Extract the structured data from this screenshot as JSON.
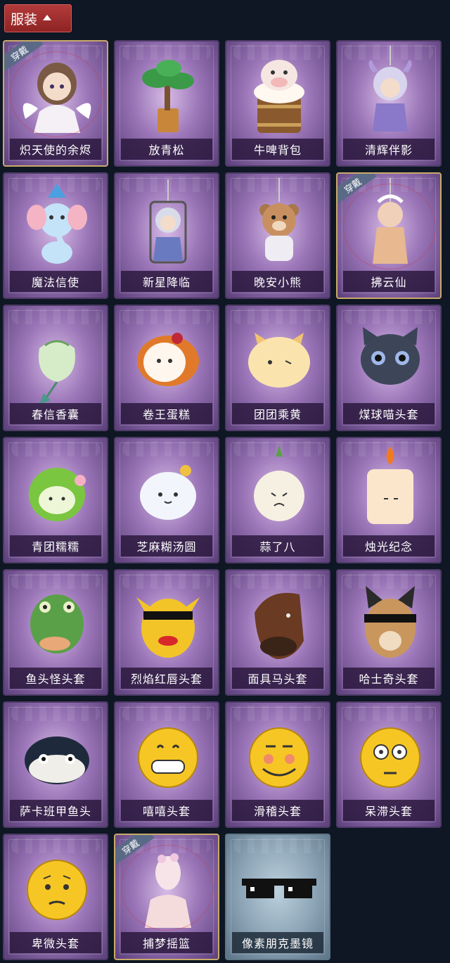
{
  "header": {
    "label": "服装"
  },
  "equipped_badge": "穿戴",
  "items": [
    {
      "name": "炽天使的余烬",
      "equipped": true,
      "icon": "angel-figure-icon"
    },
    {
      "name": "放青松",
      "equipped": false,
      "icon": "bonsai-pine-icon"
    },
    {
      "name": "牛啤背包",
      "equipped": false,
      "icon": "cow-beer-barrel-icon"
    },
    {
      "name": "清辉伴影",
      "equipped": false,
      "icon": "moon-spirit-figure-icon"
    },
    {
      "name": "魔法信使",
      "equipped": false,
      "icon": "elephant-mage-icon"
    },
    {
      "name": "新星降临",
      "equipped": false,
      "icon": "keychain-figure-icon"
    },
    {
      "name": "晚安小熊",
      "equipped": false,
      "icon": "teddy-bear-icon"
    },
    {
      "name": "拂云仙",
      "equipped": true,
      "icon": "cloud-fairy-icon"
    },
    {
      "name": "春信香囊",
      "equipped": false,
      "icon": "sachet-pouch-icon"
    },
    {
      "name": "卷王蛋糕",
      "equipped": false,
      "icon": "roll-cake-icon"
    },
    {
      "name": "团团乘黄",
      "equipped": false,
      "icon": "cat-bun-icon"
    },
    {
      "name": "煤球喵头套",
      "equipped": false,
      "icon": "black-cat-head-icon"
    },
    {
      "name": "青团糯糯",
      "equipped": false,
      "icon": "green-dumpling-icon"
    },
    {
      "name": "芝麻糊汤圆",
      "equipped": false,
      "icon": "rice-ball-icon"
    },
    {
      "name": "蒜了八",
      "equipped": false,
      "icon": "garlic-icon"
    },
    {
      "name": "烛光纪念",
      "equipped": false,
      "icon": "candle-icon"
    },
    {
      "name": "鱼头怪头套",
      "equipped": false,
      "icon": "fish-head-icon"
    },
    {
      "name": "烈焰红唇头套",
      "equipped": false,
      "icon": "pikachu-mask-icon"
    },
    {
      "name": "面具马头套",
      "equipped": false,
      "icon": "horse-head-icon"
    },
    {
      "name": "哈士奇头套",
      "equipped": false,
      "icon": "husky-head-icon"
    },
    {
      "name": "萨卡班甲鱼头",
      "equipped": false,
      "icon": "sacabambaspis-head-icon"
    },
    {
      "name": "嘻嘻头套",
      "equipped": false,
      "icon": "grin-emoji-icon"
    },
    {
      "name": "滑稽头套",
      "equipped": false,
      "icon": "funny-emoji-icon"
    },
    {
      "name": "呆滞头套",
      "equipped": false,
      "icon": "stunned-emoji-icon"
    },
    {
      "name": "卑微头套",
      "equipped": false,
      "icon": "pleading-emoji-icon"
    },
    {
      "name": "捕梦摇篮",
      "equipped": true,
      "icon": "dreamcatcher-mannequin-icon"
    },
    {
      "name": "像素朋克墨镜",
      "equipped": false,
      "icon": "pixel-sunglasses-icon",
      "special": true
    }
  ]
}
